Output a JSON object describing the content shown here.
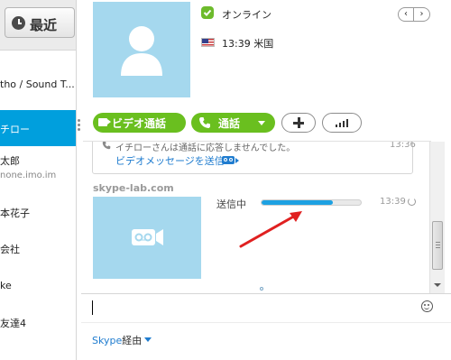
{
  "sidebar": {
    "recent_label": "最近",
    "contacts": [
      {
        "name": "tho / Sound T...",
        "sub": ""
      },
      {
        "name": "チロー",
        "sub": ""
      },
      {
        "name": "太郎",
        "sub": "none.imo.im"
      },
      {
        "name": "本花子",
        "sub": ""
      },
      {
        "name": "会社",
        "sub": ""
      },
      {
        "name": "ke",
        "sub": ""
      },
      {
        "name": "友達4",
        "sub": ""
      }
    ]
  },
  "profile": {
    "status": "オンライン",
    "local_time": "13:39 米国",
    "nav_prev": "‹",
    "nav_next": "›"
  },
  "actions": {
    "video_call": "ビデオ通話",
    "call": "通話"
  },
  "conversation": {
    "message": {
      "text": "イチローさんは通話に応答しませんでした。",
      "time": "13:36",
      "link": "ビデオメッセージを送信"
    },
    "video_message": {
      "sender": "skype-lab.com",
      "status": "送信中",
      "time": "13:39",
      "progress": 0.72
    }
  },
  "composer": {
    "via_brand": "Skype",
    "via_suffix": "経由"
  },
  "colors": {
    "accent": "#009fdd",
    "call_green": "#6abf1f",
    "link_blue": "#1f7ccf",
    "progress_blue": "#1da1e2",
    "annotation_arrow": "#e02020"
  }
}
